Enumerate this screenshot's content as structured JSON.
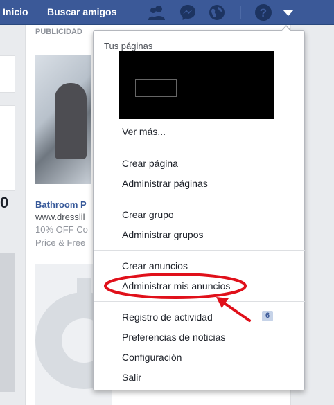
{
  "topbar": {
    "inicio": "Inicio",
    "buscar_amigos": "Buscar amigos"
  },
  "background": {
    "ad_header": "PUBLICIDAD",
    "ad_title": "Bathroom P",
    "ad_url": "www.dresslil",
    "ad_text1": "10% OFF Co",
    "ad_text2": "Price & Free",
    "left_partial_text": "0"
  },
  "dropdown": {
    "heading": "Tus páginas",
    "ver_mas": "Ver más...",
    "crear_pagina": "Crear página",
    "administrar_paginas": "Administrar páginas",
    "crear_grupo": "Crear grupo",
    "administrar_grupos": "Administrar grupos",
    "crear_anuncios": "Crear anuncios",
    "administrar_mis_anuncios": "Administrar mis anuncios",
    "registro_actividad": "Registro de actividad",
    "registro_badge": "6",
    "preferencias": "Preferencias de noticias",
    "configuracion": "Configuración",
    "salir": "Salir"
  },
  "colors": {
    "brand_blue": "#3b5998",
    "annotation_red": "#e0101a"
  },
  "icons": [
    "friends-icon",
    "messenger-icon",
    "globe-icon",
    "help-icon",
    "caret-down-icon"
  ]
}
